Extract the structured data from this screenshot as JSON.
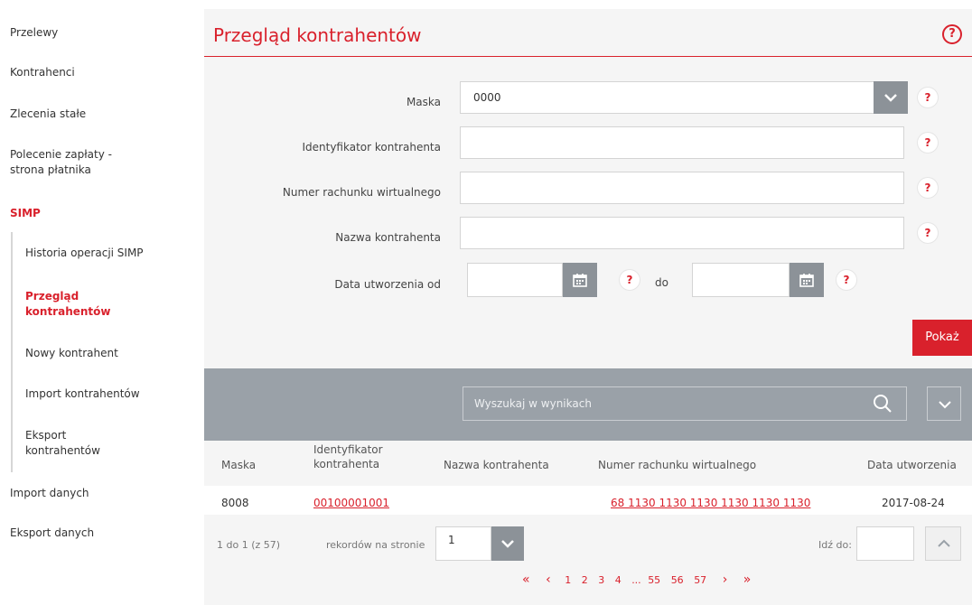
{
  "sidebar": {
    "items": [
      {
        "label": "Przelewy"
      },
      {
        "label": "Kontrahenci"
      },
      {
        "label": "Zlecenia stałe"
      },
      {
        "label": "Polecenie zapłaty - strona płatnika"
      },
      {
        "label": "SIMP"
      }
    ],
    "sub_items": [
      {
        "label": "Historia operacji SIMP"
      },
      {
        "label": "Przegląd kontrahentów"
      },
      {
        "label": "Nowy kontrahent"
      },
      {
        "label": "Import kontrahentów"
      },
      {
        "label": "Eksport kontrahentów"
      }
    ],
    "bottom_items": [
      {
        "label": "Import danych"
      },
      {
        "label": "Eksport danych"
      }
    ]
  },
  "page": {
    "title": "Przegląd kontrahentów",
    "help": "?"
  },
  "form": {
    "maska_label": "Maska",
    "maska_value": "0000",
    "identyfikator_label": "Identyfikator kontrahenta",
    "identyfikator_value": "",
    "numer_label": "Numer rachunku wirtualnego",
    "numer_value": "",
    "nazwa_label": "Nazwa kontrahenta",
    "nazwa_value": "",
    "data_od_label": "Data utworzenia od",
    "data_od_value": "",
    "do_label": "do",
    "data_do_value": "",
    "help": "?",
    "submit_label": "Pokaż"
  },
  "results": {
    "search_placeholder": "Wyszukaj w wynikach",
    "columns": [
      "Maska",
      "Identyfikator kontrahenta",
      "Nazwa kontrahenta",
      "Numer rachunku wirtualnego",
      "Data utworzenia"
    ],
    "rows": [
      {
        "maska": "8008",
        "identyfikator": "00100001001",
        "nazwa": "",
        "numer": "68 1130 1130 1130 1130 1130 1130",
        "data": "2017-08-24"
      }
    ]
  },
  "pagination": {
    "range_text": "1 do 1 (z 57)",
    "per_page_label": "rekordów na stronie",
    "per_page_value": "1",
    "goto_label": "Idź do:",
    "first": "«",
    "prev": "‹",
    "pages": [
      "1",
      "2",
      "3",
      "4",
      "...",
      "55",
      "56",
      "57"
    ],
    "next": "›",
    "last": "»"
  },
  "colors": {
    "accent": "#d9212c",
    "toolbar": "#9aa1a8",
    "button_grey": "#8c9298"
  }
}
